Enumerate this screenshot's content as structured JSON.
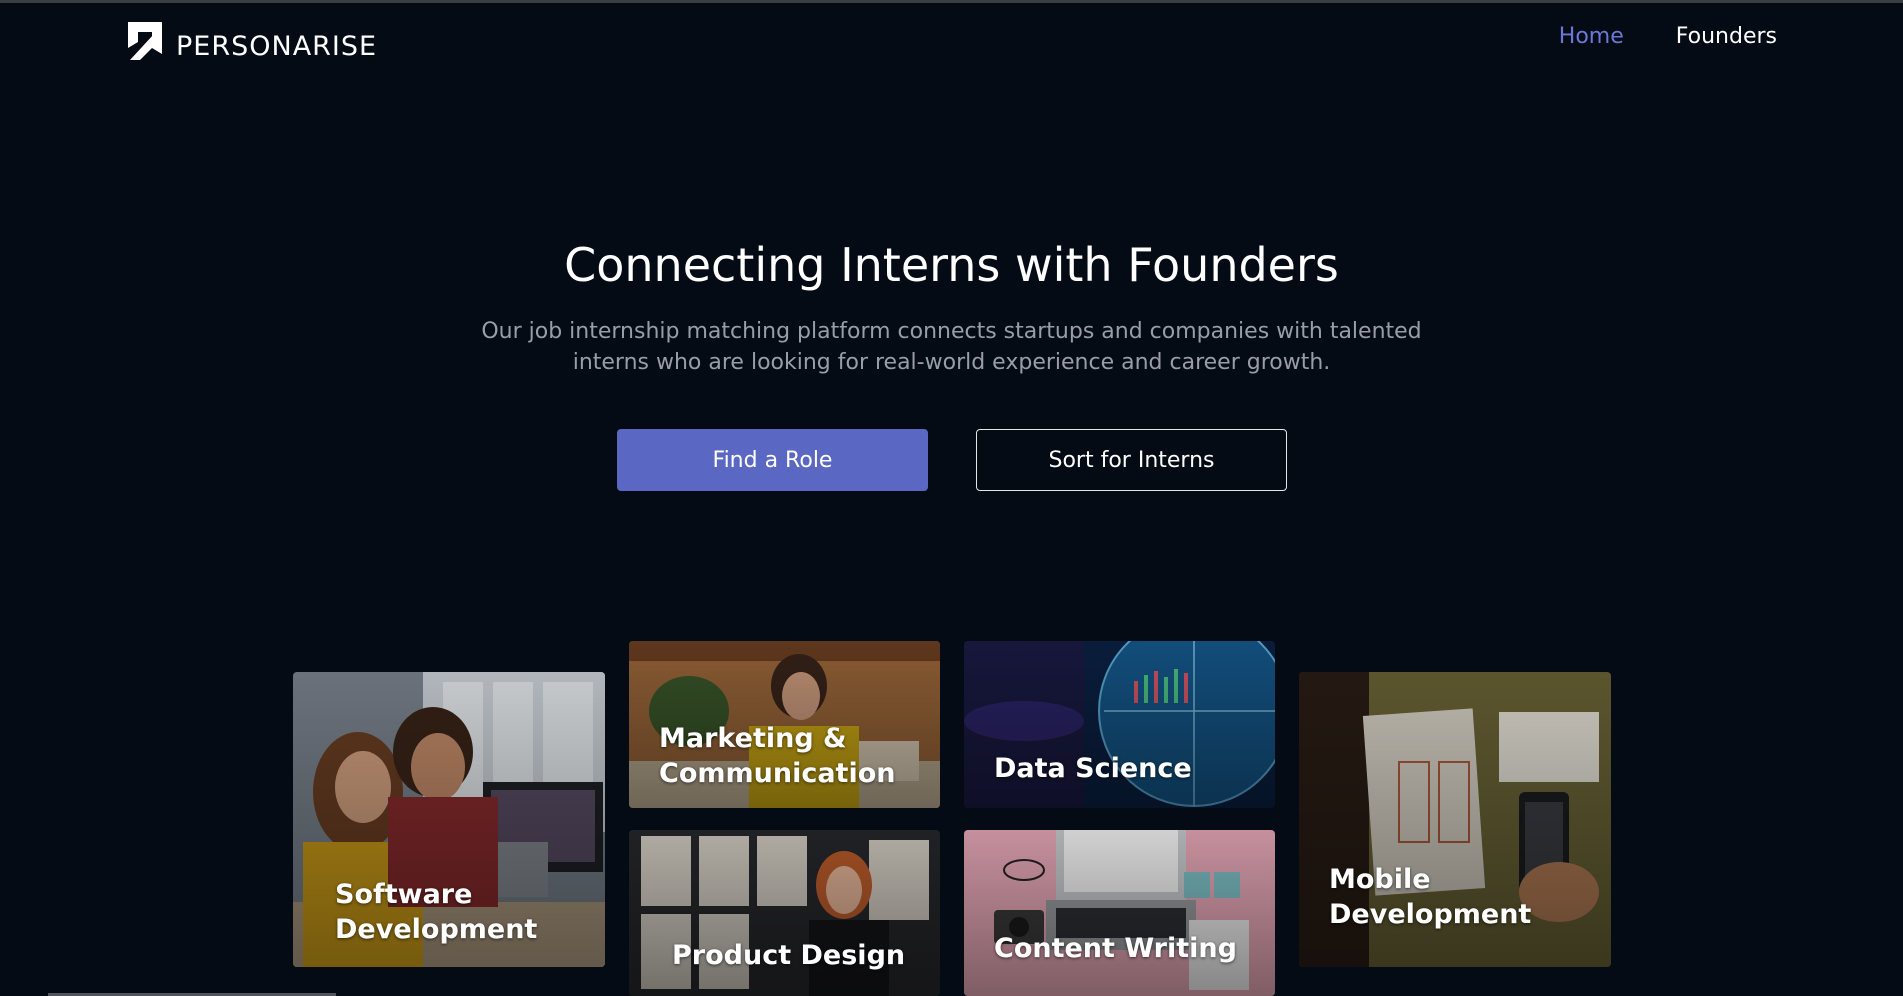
{
  "brand": {
    "name": "PERSONARISE",
    "logo_icon": "arrow-up-right-logo-icon"
  },
  "nav": {
    "items": [
      {
        "label": "Home",
        "active": true
      },
      {
        "label": "Founders",
        "active": false
      }
    ],
    "active_color": "#6b78d6"
  },
  "hero": {
    "title": "Connecting Interns with Founders",
    "subtitle": "Our job internship matching platform connects startups and companies with talented interns who are looking for real-world experience and career growth.",
    "primary_button": "Find a Role",
    "secondary_button": "Sort for Interns"
  },
  "categories": {
    "software": "Software Development",
    "marketing": "Marketing & Communication",
    "data_science": "Data Science",
    "mobile": "Mobile Development",
    "product_design": "Product Design",
    "content_writing": "Content Writing"
  },
  "colors": {
    "background": "#040b15",
    "primary_button": "#5a67c3",
    "subtitle_text": "#9a9da6"
  }
}
